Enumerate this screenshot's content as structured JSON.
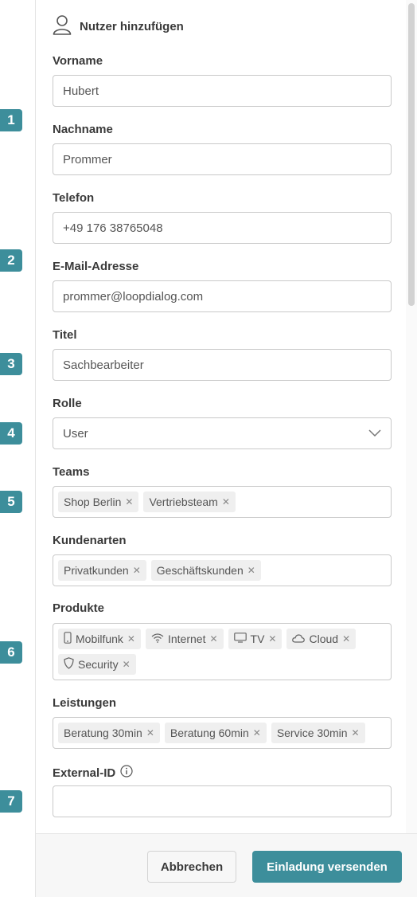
{
  "dialog": {
    "title": "Nutzer hinzufügen",
    "title_icon": "user-icon"
  },
  "steps": [
    "1",
    "2",
    "3",
    "4",
    "5",
    "6",
    "7"
  ],
  "fields": {
    "vorname": {
      "label": "Vorname",
      "value": "Hubert"
    },
    "nachname": {
      "label": "Nachname",
      "value": "Prommer"
    },
    "telefon": {
      "label": "Telefon",
      "value": "+49 176 38765048"
    },
    "email": {
      "label": "E-Mail-Adresse",
      "value": "prommer@loopdialog.com"
    },
    "titel": {
      "label": "Titel",
      "value": "Sachbearbeiter"
    },
    "rolle": {
      "label": "Rolle",
      "value": "User"
    },
    "teams": {
      "label": "Teams",
      "tags": [
        "Shop Berlin",
        "Vertriebsteam"
      ]
    },
    "kundenarten": {
      "label": "Kundenarten",
      "tags": [
        "Privatkunden",
        "Geschäftskunden"
      ]
    },
    "produkte": {
      "label": "Produkte",
      "tags": [
        {
          "label": "Mobilfunk",
          "icon": "phone-icon"
        },
        {
          "label": "Internet",
          "icon": "wifi-icon"
        },
        {
          "label": "TV",
          "icon": "tv-icon"
        },
        {
          "label": "Cloud",
          "icon": "cloud-icon"
        },
        {
          "label": "Security",
          "icon": "shield-icon"
        }
      ]
    },
    "leistungen": {
      "label": "Leistungen",
      "tags": [
        "Beratung 30min",
        "Beratung 60min",
        "Service 30min"
      ]
    },
    "external_id": {
      "label": "External-ID",
      "value": ""
    }
  },
  "footer": {
    "cancel_label": "Abbrechen",
    "submit_label": "Einladung versenden"
  },
  "colors": {
    "accent": "#3d8e9b"
  }
}
